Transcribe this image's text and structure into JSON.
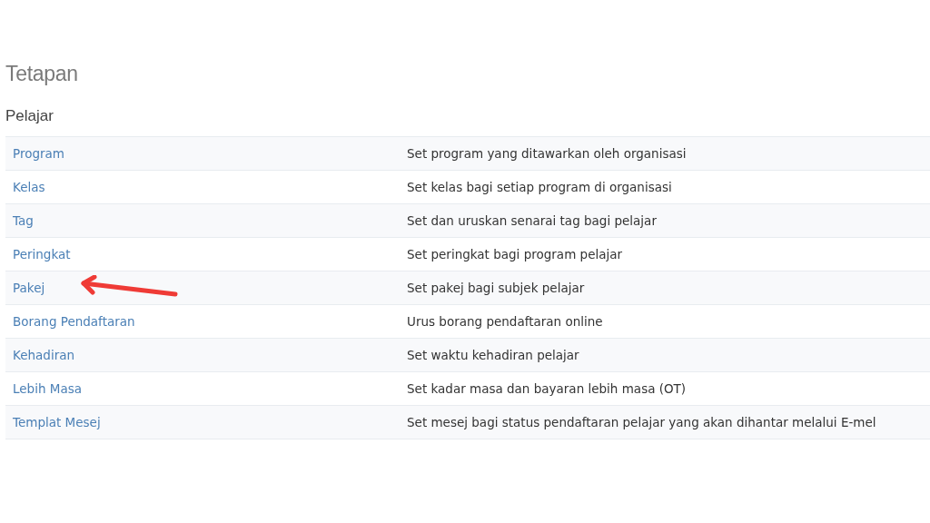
{
  "page_title": "Tetapan",
  "section_title": "Pelajar",
  "rows": [
    {
      "name": "Program",
      "description": "Set program yang ditawarkan oleh organisasi",
      "marked": false
    },
    {
      "name": "Kelas",
      "description": "Set kelas bagi setiap program di organisasi",
      "marked": false
    },
    {
      "name": "Tag",
      "description": "Set dan uruskan senarai tag bagi pelajar",
      "marked": false
    },
    {
      "name": "Peringkat",
      "description": "Set peringkat bagi program pelajar",
      "marked": false
    },
    {
      "name": "Pakej",
      "description": "Set pakej bagi subjek pelajar",
      "marked": true
    },
    {
      "name": "Borang Pendaftaran",
      "description": "Urus borang pendaftaran online",
      "marked": false
    },
    {
      "name": "Kehadiran",
      "description": "Set waktu kehadiran pelajar",
      "marked": false
    },
    {
      "name": "Lebih Masa",
      "description": "Set kadar masa dan bayaran lebih masa (OT)",
      "marked": false
    },
    {
      "name": "Templat Mesej",
      "description": "Set mesej bagi status pendaftaran pelajar yang akan dihantar melalui E-mel",
      "marked": false
    }
  ]
}
